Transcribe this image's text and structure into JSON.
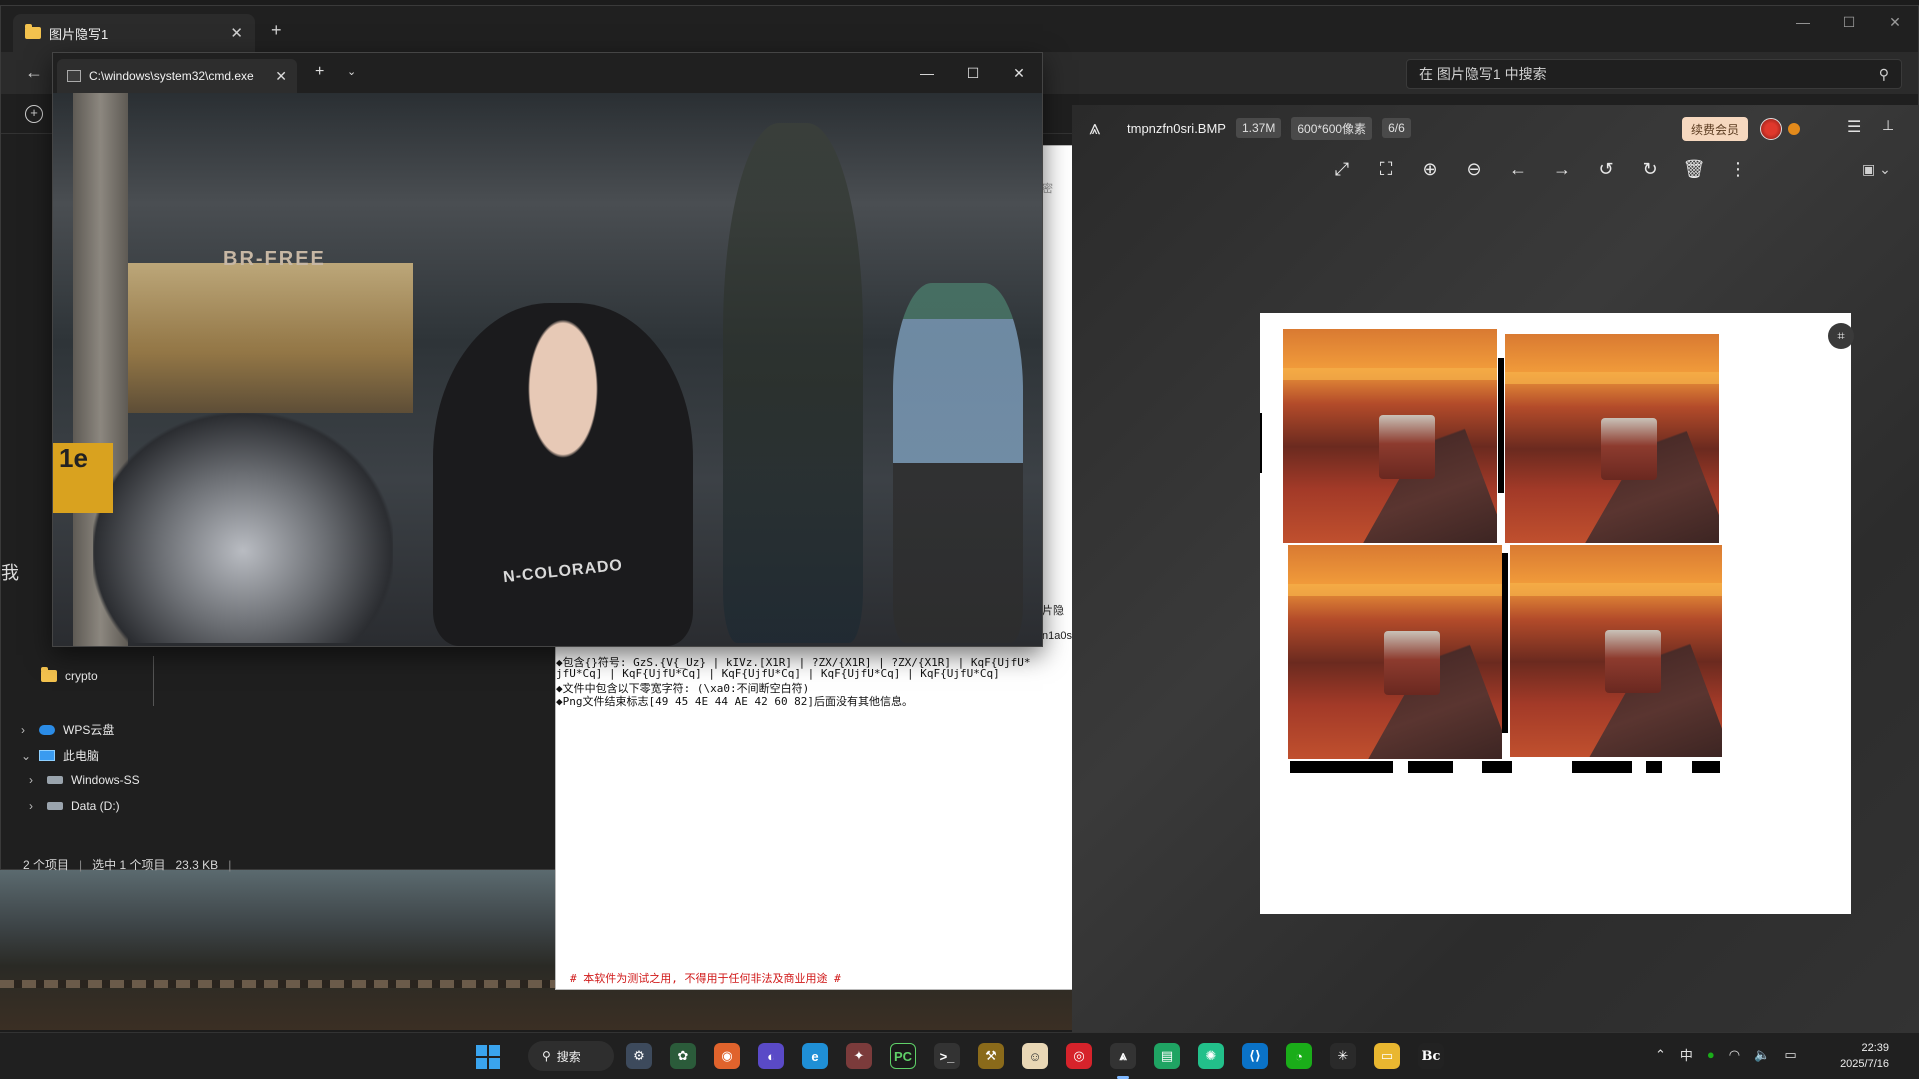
{
  "explorer": {
    "tab_title": "图片隐写1",
    "search_placeholder": "在 图片隐写1 中搜索",
    "nav": {
      "crypto": "crypto",
      "wps": "WPS云盘",
      "this_pc": "此电脑",
      "windows": "Windows-SS",
      "data_d": "Data (D:)"
    },
    "status": {
      "items": "2 个项目",
      "selected": "选中 1 个项目",
      "size": "23.3 KB"
    },
    "side_char": "我"
  },
  "terminal": {
    "tab_title": "C:\\windows\\system32\\cmd.exe"
  },
  "cmd_output": {
    "line1": "◆包含{}符号: GzS.{V{_Uz} | kIVz.[X1R] | ?ZX/{X1R] | ?ZX/{X1R] | KqF{UjfU*",
    "line2": "jfU*Cq] | KqF{UjfU*Cq] | KqF{UjfU*Cq] | KqF{UjfU*Cq] | KqF{UjfU*Cq]",
    "line3": "◆文件中包含以下零宽字符: (\\xa0:不间断空白符)",
    "line4": "◆Png文件结束标志[49 45 4E 44 AE 42 60 82]后面没有其他信息。",
    "warning": "# 本软件为测试之用, 不得用于任何非法及商业用途 #",
    "side1": "片隐",
    "side2": "n1a0s",
    "side3": "密"
  },
  "viewer": {
    "filename": "tmpnzfn0sri.BMP",
    "filesize": "1.37M",
    "dimensions": "600*600像素",
    "index": "6/6",
    "vip_label": "续费会员"
  },
  "taskbar": {
    "search_label": "搜索",
    "tray_lang": "中",
    "time": "22:39",
    "date": "2025/7/16"
  }
}
